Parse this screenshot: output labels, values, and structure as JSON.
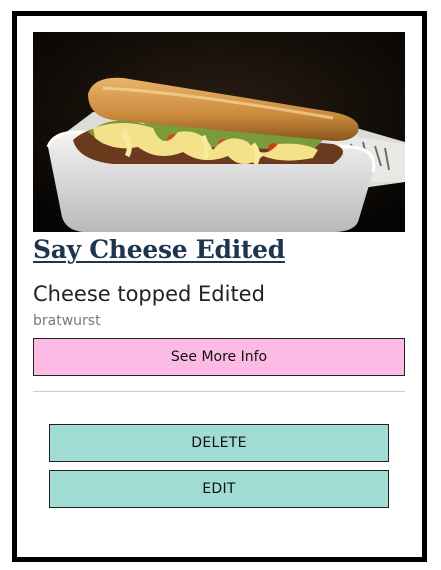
{
  "card": {
    "image_alt": "Sandwich topped with melted cheese in a foam tray",
    "title": "Say Cheese Edited",
    "subtitle": "Cheese topped Edited",
    "category": "bratwurst",
    "more_info_label": "See More Info",
    "delete_label": "DELETE",
    "edit_label": "EDIT"
  },
  "colors": {
    "title": "#1e3550",
    "more_info_bg": "#fbbbe4",
    "action_bg": "#a0dcd3",
    "border": "#000000"
  }
}
